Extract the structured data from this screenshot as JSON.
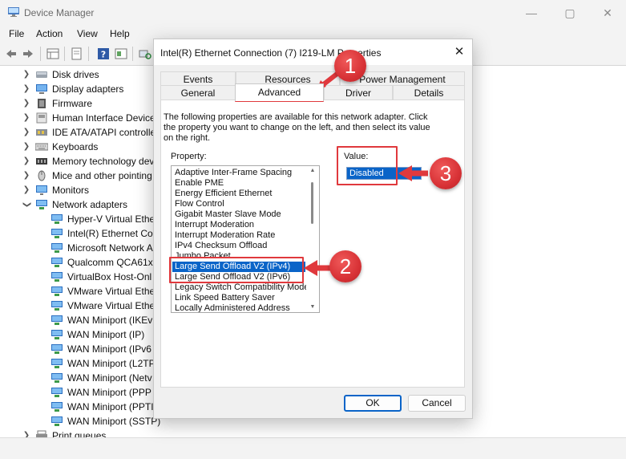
{
  "window": {
    "title": "Device Manager",
    "controls": {
      "minimize": "—",
      "maximize": "▢",
      "close": "✕"
    }
  },
  "menu": [
    "File",
    "Action",
    "View",
    "Help"
  ],
  "toolbar_icons": [
    "back-icon",
    "forward-icon",
    "properties-grid-icon",
    "update-driver-icon",
    "help-icon",
    "view-icon",
    "scan-hardware-icon"
  ],
  "tree": {
    "categories_top": [
      {
        "label": "Disk drives",
        "icon": "disk-icon"
      },
      {
        "label": "Display adapters",
        "icon": "display-icon"
      },
      {
        "label": "Firmware",
        "icon": "firmware-icon"
      },
      {
        "label": "Human Interface Device",
        "icon": "hid-icon"
      },
      {
        "label": "IDE ATA/ATAPI controlle",
        "icon": "ide-icon"
      },
      {
        "label": "Keyboards",
        "icon": "keyboard-icon"
      },
      {
        "label": "Memory technology dev",
        "icon": "memory-icon"
      },
      {
        "label": "Mice and other pointing",
        "icon": "mouse-icon"
      },
      {
        "label": "Monitors",
        "icon": "monitor-icon"
      }
    ],
    "network": {
      "label": "Network adapters",
      "children": [
        "Hyper-V Virtual Ethe",
        "Intel(R) Ethernet Cor",
        "Microsoft Network A",
        "Qualcomm QCA61x",
        "VirtualBox Host-Onl",
        "VMware Virtual Ethe",
        "VMware Virtual Ethe",
        "WAN Miniport (IKEv",
        "WAN Miniport (IP)",
        "WAN Miniport (IPv6",
        "WAN Miniport (L2TP",
        "WAN Miniport (Netv",
        "WAN Miniport (PPP",
        "WAN Miniport (PPTI",
        "WAN Miniport (SSTP)"
      ]
    },
    "after": [
      {
        "label": "Print queues",
        "icon": "printer-icon"
      }
    ]
  },
  "dialog": {
    "title": "Intel(R) Ethernet Connection (7) I219-LM Properties",
    "close": "✕",
    "tabs_back": [
      "Events",
      "Resources",
      "Power Management"
    ],
    "tabs_front": [
      "General",
      "Advanced",
      "Driver",
      "Details"
    ],
    "active_tab": "Advanced",
    "description": "The following properties are available for this network adapter. Click the property you want to change on the left, and then select its value on the right.",
    "property_label": "Property:",
    "value_label": "Value:",
    "properties": [
      "Adaptive Inter-Frame Spacing",
      "Enable PME",
      "Energy Efficient Ethernet",
      "Flow Control",
      "Gigabit Master Slave Mode",
      "Interrupt Moderation",
      "Interrupt Moderation Rate",
      "IPv4 Checksum Offload",
      "Jumbo Packet",
      "Large Send Offload V2 (IPv4)",
      "Large Send Offload V2 (IPv6)",
      "Legacy Switch Compatibility Mode",
      "Link Speed Battery Saver",
      "Locally Administered Address"
    ],
    "selected_property": "Large Send Offload V2 (IPv4)",
    "value": "Disabled",
    "ok": "OK",
    "cancel": "Cancel"
  },
  "annotations": {
    "badge1": "1",
    "badge2": "2",
    "badge3": "3",
    "color": "#e0393d"
  }
}
